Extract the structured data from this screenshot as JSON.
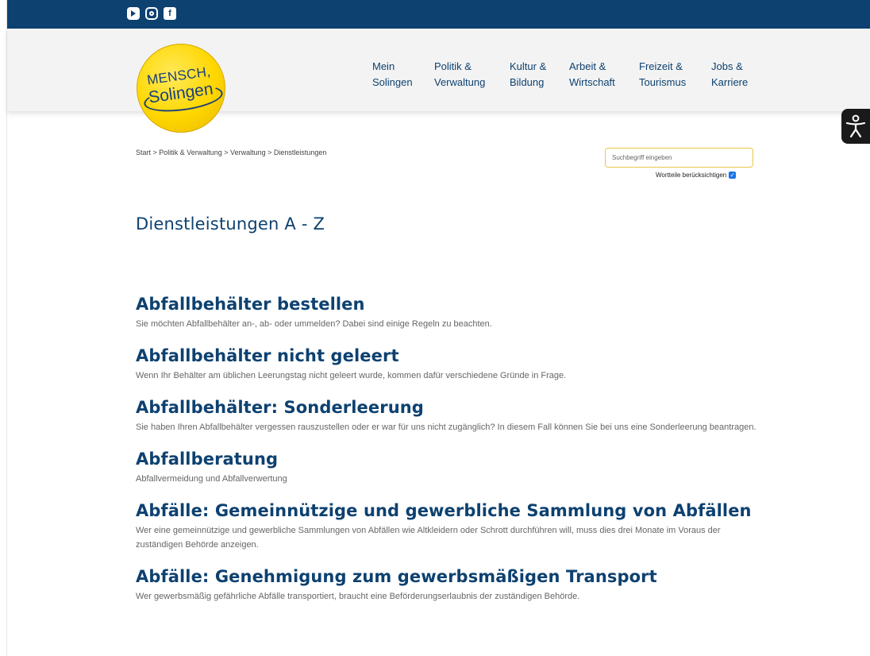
{
  "social": [
    "youtube-icon",
    "instagram-icon",
    "facebook-icon"
  ],
  "logo": {
    "line1": "MENSCH,",
    "line2": "Solingen"
  },
  "nav": [
    {
      "line1": "Mein",
      "line2": "Solingen"
    },
    {
      "line1": "Politik &",
      "line2": "Verwaltung"
    },
    {
      "line1": "Kultur &",
      "line2": "Bildung"
    },
    {
      "line1": "Arbeit &",
      "line2": "Wirtschaft"
    },
    {
      "line1": "Freizeit &",
      "line2": "Tourismus"
    },
    {
      "line1": "Jobs &",
      "line2": "Karriere"
    }
  ],
  "breadcrumb": "Start > Politik & Verwaltung > Verwaltung > Dienstleistungen",
  "search": {
    "placeholder": "Suchbegriff eingeben",
    "value": ""
  },
  "wordparts_label": "Wortteile berücksichtigen",
  "wordparts_checked": true,
  "page_title": "Dienstleistungen A - Z",
  "services": [
    {
      "title": "Abfallbehälter bestellen",
      "desc": "Sie möchten Abfallbehälter an-, ab- oder ummelden? Dabei sind einige Regeln zu beachten."
    },
    {
      "title": "Abfallbehälter nicht geleert",
      "desc": "Wenn Ihr Behälter am üblichen Leerungstag nicht geleert wurde, kommen dafür verschiedene Gründe in Frage."
    },
    {
      "title": "Abfallbehälter: Sonderleerung",
      "desc": "Sie haben Ihren Abfallbehälter vergessen rauszustellen oder er war für uns nicht zugänglich? In diesem Fall können Sie bei uns eine Sonderleerung beantragen."
    },
    {
      "title": "Abfallberatung",
      "desc": "Abfallvermeidung und Abfallverwertung"
    },
    {
      "title": "Abfälle: Gemeinnützige und gewerbliche Sammlung von Abfällen",
      "desc": "Wer eine gemeinnützige und gewerbliche Sammlungen von Abfällen wie Altkleidern oder Schrott durchführen will, muss dies drei Monate im Voraus der zuständigen Behörde anzeigen."
    },
    {
      "title": "Abfälle: Genehmigung zum gewerbsmäßigen Transport",
      "desc": "Wer gewerbsmäßig gefährliche Abfälle transportiert, braucht eine Beförderungserlaubnis der zuständigen Behörde."
    }
  ],
  "colors": {
    "brand_blue": "#0d4170",
    "logo_yellow": "#ffd700",
    "checkbox_blue": "#1a73e8"
  }
}
